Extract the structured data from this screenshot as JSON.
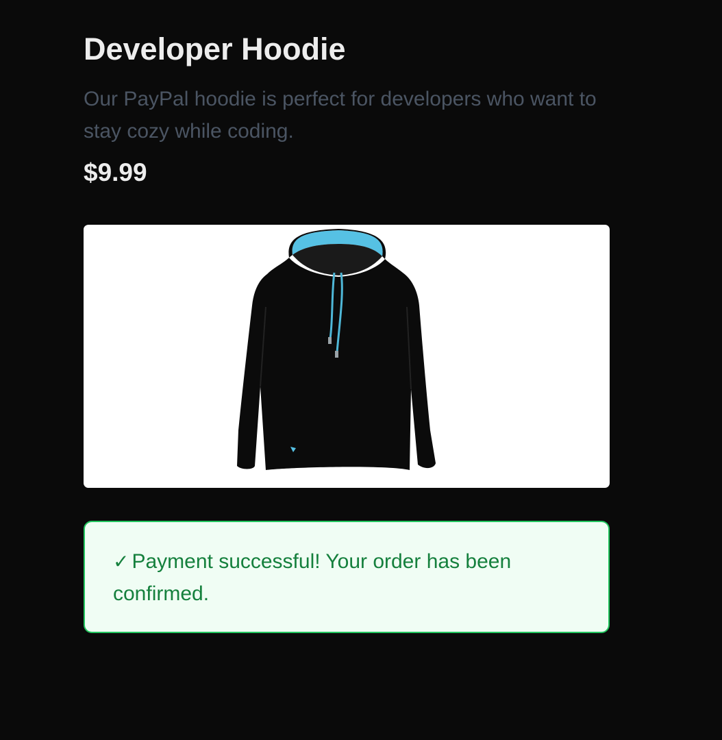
{
  "product": {
    "title": "Developer Hoodie",
    "description": "Our PayPal hoodie is perfect for developers who want to stay cozy while coding.",
    "price": "$9.99",
    "image_icon": "hoodie-image",
    "image_colors": {
      "body": "#0b0b0b",
      "hood_lining": "#56c1e4",
      "drawstring": "#4fb8d8"
    }
  },
  "status": {
    "icon": "✓",
    "message": "Payment successful! Your order has been confirmed.",
    "colors": {
      "background": "#f0fdf4",
      "border": "#22c55e",
      "text": "#15803d"
    }
  }
}
